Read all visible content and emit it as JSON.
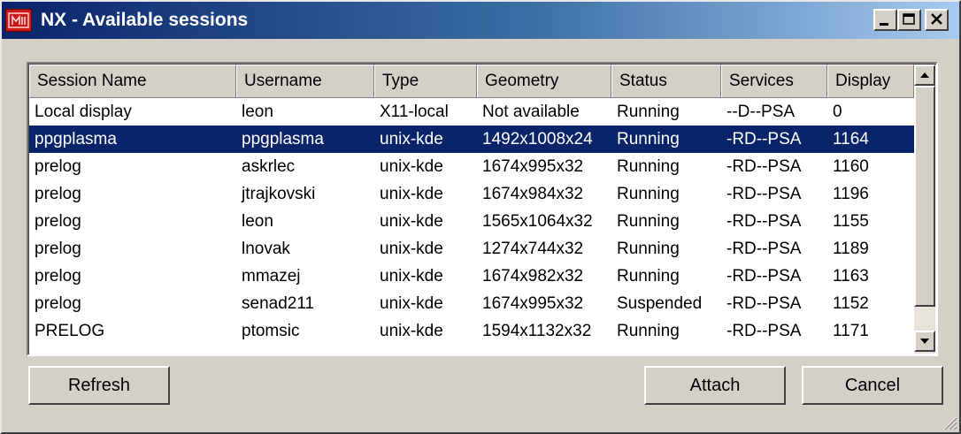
{
  "window": {
    "title": "NX - Available sessions",
    "icon": "nx-app-icon",
    "controls": [
      "minimize-icon",
      "maximize-icon",
      "close-icon"
    ]
  },
  "table": {
    "columns": [
      "Session Name",
      "Username",
      "Type",
      "Geometry",
      "Status",
      "Services",
      "Display"
    ],
    "selected_row": 1,
    "selection_color": "#0a246a",
    "rows": [
      [
        "Local display",
        "leon",
        "X11-local",
        "Not available",
        "Running",
        "--D--PSA",
        "0"
      ],
      [
        "ppgplasma",
        "ppgplasma",
        "unix-kde",
        "1492x1008x24",
        "Running",
        "-RD--PSA",
        "1164"
      ],
      [
        "prelog",
        "askrlec",
        "unix-kde",
        "1674x995x32",
        "Running",
        "-RD--PSA",
        "1160"
      ],
      [
        "prelog",
        "jtrajkovski",
        "unix-kde",
        "1674x984x32",
        "Running",
        "-RD--PSA",
        "1196"
      ],
      [
        "prelog",
        "leon",
        "unix-kde",
        "1565x1064x32",
        "Running",
        "-RD--PSA",
        "1155"
      ],
      [
        "prelog",
        "lnovak",
        "unix-kde",
        "1274x744x32",
        "Running",
        "-RD--PSA",
        "1189"
      ],
      [
        "prelog",
        "mmazej",
        "unix-kde",
        "1674x982x32",
        "Running",
        "-RD--PSA",
        "1163"
      ],
      [
        "prelog",
        "senad211",
        "unix-kde",
        "1674x995x32",
        "Suspended",
        "-RD--PSA",
        "1152"
      ],
      [
        "PRELOG",
        "ptomsic",
        "unix-kde",
        "1594x1132x32",
        "Running",
        "-RD--PSA",
        "1171"
      ]
    ]
  },
  "buttons": {
    "refresh": "Refresh",
    "attach": "Attach",
    "cancel": "Cancel"
  }
}
